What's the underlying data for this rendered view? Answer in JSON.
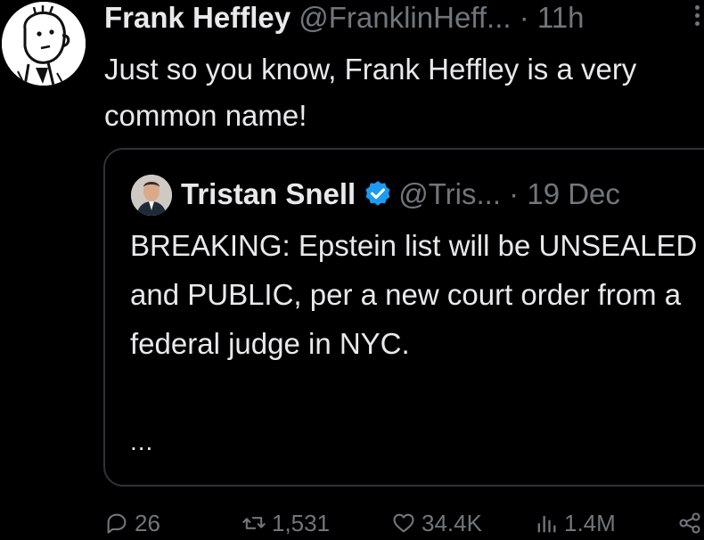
{
  "post": {
    "author_name": "Frank Heffley",
    "author_handle": "@FranklinHeff...",
    "separator": "·",
    "time": "11h",
    "text": "Just so you know, Frank Heffley is a very common name!"
  },
  "quoted_post": {
    "author_name": "Tristan Snell",
    "author_handle": "@Tris...",
    "separator": "·",
    "time": "19 Dec",
    "verified": true,
    "text": "BREAKING: Epstein list will be UNSEALED and PUBLIC, per a new court order from a federal judge in NYC.",
    "more": "..."
  },
  "actions": {
    "replies": "26",
    "reposts": "1,531",
    "likes": "34.4K",
    "views": "1.4M"
  },
  "icons": {
    "reply": "reply-icon",
    "repost": "repost-icon",
    "like": "heart-icon",
    "views": "views-icon",
    "share": "share-icon",
    "verified": "verified-badge-icon",
    "more": "more-dots-icon"
  },
  "colors": {
    "background": "#000000",
    "text": "#e7e9ea",
    "muted": "#71767b",
    "border": "#2f3336",
    "verified": "#1d9bf0"
  }
}
